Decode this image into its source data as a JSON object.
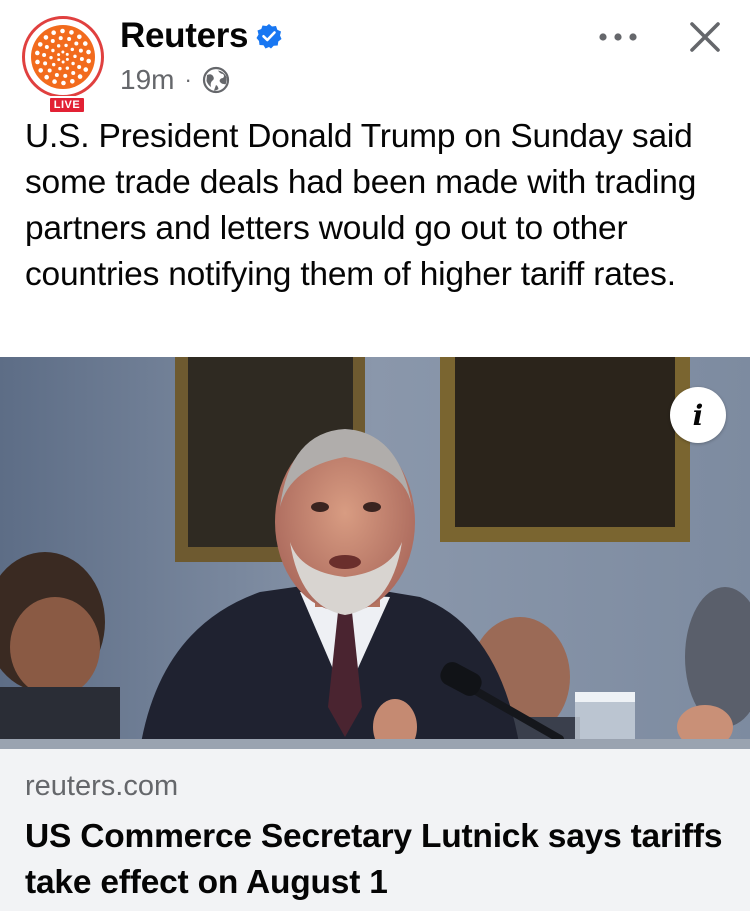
{
  "post": {
    "author": "Reuters",
    "live_badge": "LIVE",
    "time": "19m",
    "separator": "·",
    "text": "U.S. President Donald Trump on Sunday said some trade deals had been made with trading partners and letters would go out to other countries notifying them of higher tariff rates."
  },
  "icons": {
    "verified": "verified-badge-icon",
    "audience": "globe-icon",
    "more": "more-options-icon",
    "close": "close-icon",
    "info": "info-icon"
  },
  "link_card": {
    "domain": "reuters.com",
    "headline": "US Commerce Secretary Lutnick says tariffs take effect on August 1",
    "info_label": "i"
  },
  "colors": {
    "brand_orange": "#f26b1d",
    "live_red": "#e22134",
    "verified_blue": "#1877f2",
    "secondary_text": "#65676b",
    "card_background": "#f2f3f5"
  }
}
